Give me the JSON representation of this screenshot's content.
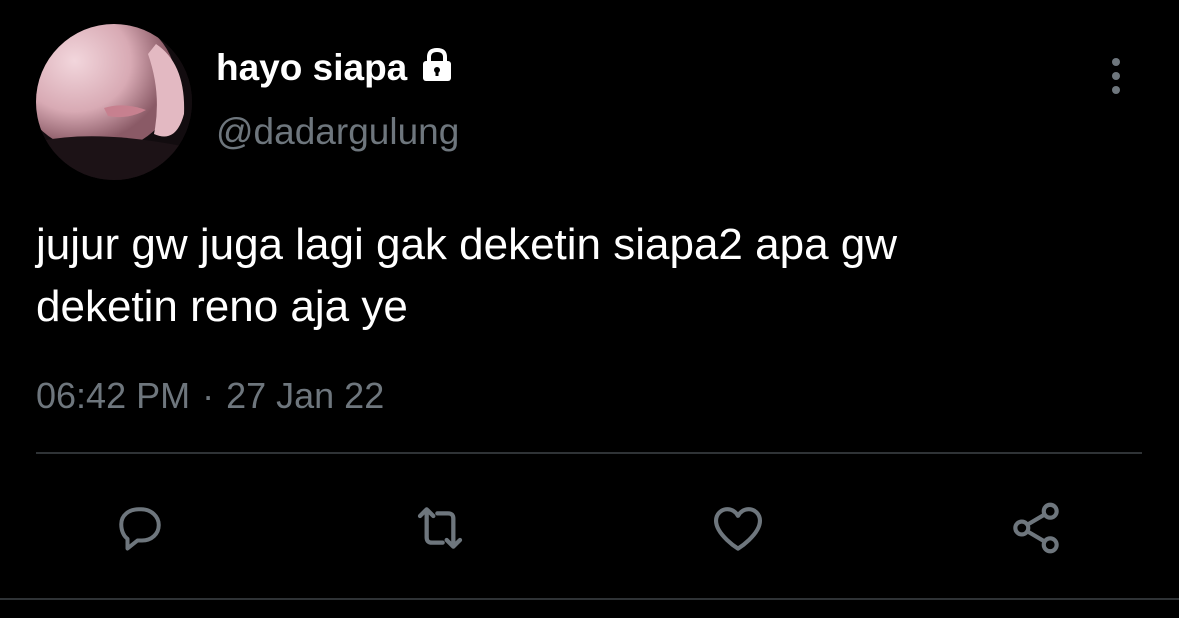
{
  "tweet": {
    "display_name": "hayo siapa",
    "handle": "@dadargulung",
    "text": "jujur gw juga lagi gak deketin siapa2 apa gw\ndeketin reno aja ye",
    "time": "06:42 PM",
    "separator": "·",
    "date": "27 Jan 22",
    "protected_icon": "lock-icon",
    "more_icon": "more-vertical-icon"
  },
  "actions": [
    {
      "name": "reply",
      "icon": "reply-icon"
    },
    {
      "name": "retweet",
      "icon": "retweet-icon"
    },
    {
      "name": "like",
      "icon": "heart-icon"
    },
    {
      "name": "share",
      "icon": "share-icon"
    }
  ],
  "colors": {
    "background": "#000000",
    "primary_text": "#ffffff",
    "secondary_text": "#6e767d",
    "divider": "#2f3336",
    "icon": "#6e767d"
  }
}
